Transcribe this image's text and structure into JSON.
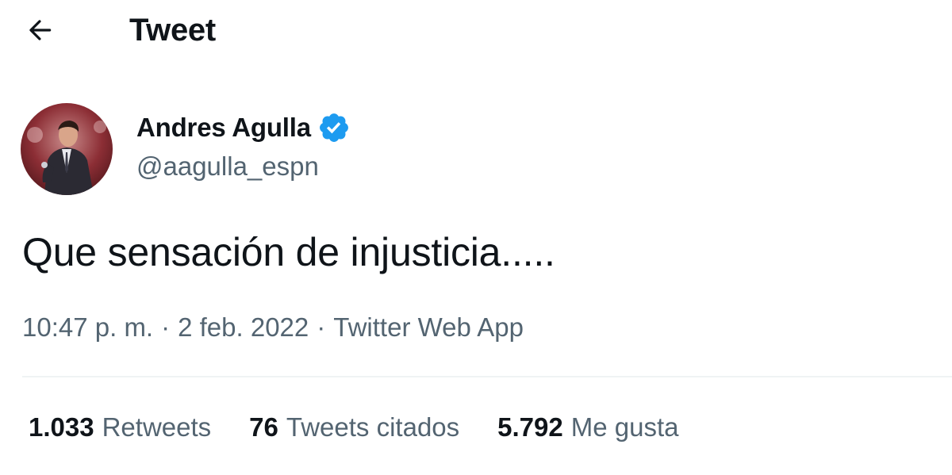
{
  "header": {
    "back_icon": "arrow-left-icon",
    "title": "Tweet"
  },
  "author": {
    "name": "Andres Agulla",
    "handle": "@aagulla_espn",
    "verified_icon": "verified-badge-icon",
    "verified_color": "#1d9bf0"
  },
  "tweet": {
    "text": "Que sensación de injusticia.....",
    "time": "10:47 p. m.",
    "date": "2 feb. 2022",
    "source": "Twitter Web App",
    "separator": "·"
  },
  "stats": [
    {
      "count": "1.033",
      "label": "Retweets"
    },
    {
      "count": "76",
      "label": "Tweets citados"
    },
    {
      "count": "5.792",
      "label": "Me gusta"
    }
  ],
  "colors": {
    "text_primary": "#0f1419",
    "text_secondary": "#536471",
    "divider": "#eff3f4"
  }
}
